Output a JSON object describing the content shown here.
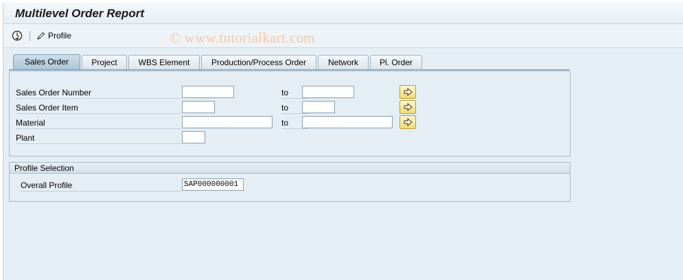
{
  "window": {
    "title": "Multilevel Order Report"
  },
  "toolbar": {
    "execute_icon": "clock-execute-icon",
    "profile_icon": "pencil-icon",
    "profile_label": "Profile",
    "watermark": "© www.tutorialkart.com"
  },
  "tabs": [
    {
      "label": "Sales Order",
      "active": true
    },
    {
      "label": "Project",
      "active": false
    },
    {
      "label": "WBS Element",
      "active": false
    },
    {
      "label": "Production/Process Order",
      "active": false
    },
    {
      "label": "Network",
      "active": false
    },
    {
      "label": "Pl. Order",
      "active": false
    }
  ],
  "selection": {
    "rows": [
      {
        "label": "Sales Order Number",
        "from": "",
        "to_label": "to",
        "to": "",
        "multi_icon": "multiple-selection-arrow-icon"
      },
      {
        "label": "Sales Order Item",
        "from": "",
        "to_label": "to",
        "to": "",
        "multi_icon": "multiple-selection-arrow-icon"
      },
      {
        "label": "Material",
        "from": "",
        "to_label": "to",
        "to": "",
        "multi_icon": "multiple-selection-arrow-icon"
      },
      {
        "label": "Plant",
        "from": ""
      }
    ]
  },
  "profile_selection": {
    "title": "Profile Selection",
    "overall_profile_label": "Overall Profile",
    "overall_profile_value": "SAP000000001"
  },
  "colors": {
    "background": "#e5eef4",
    "active_tab": "#a9c3d6",
    "arrow_button": "#f3da73"
  }
}
